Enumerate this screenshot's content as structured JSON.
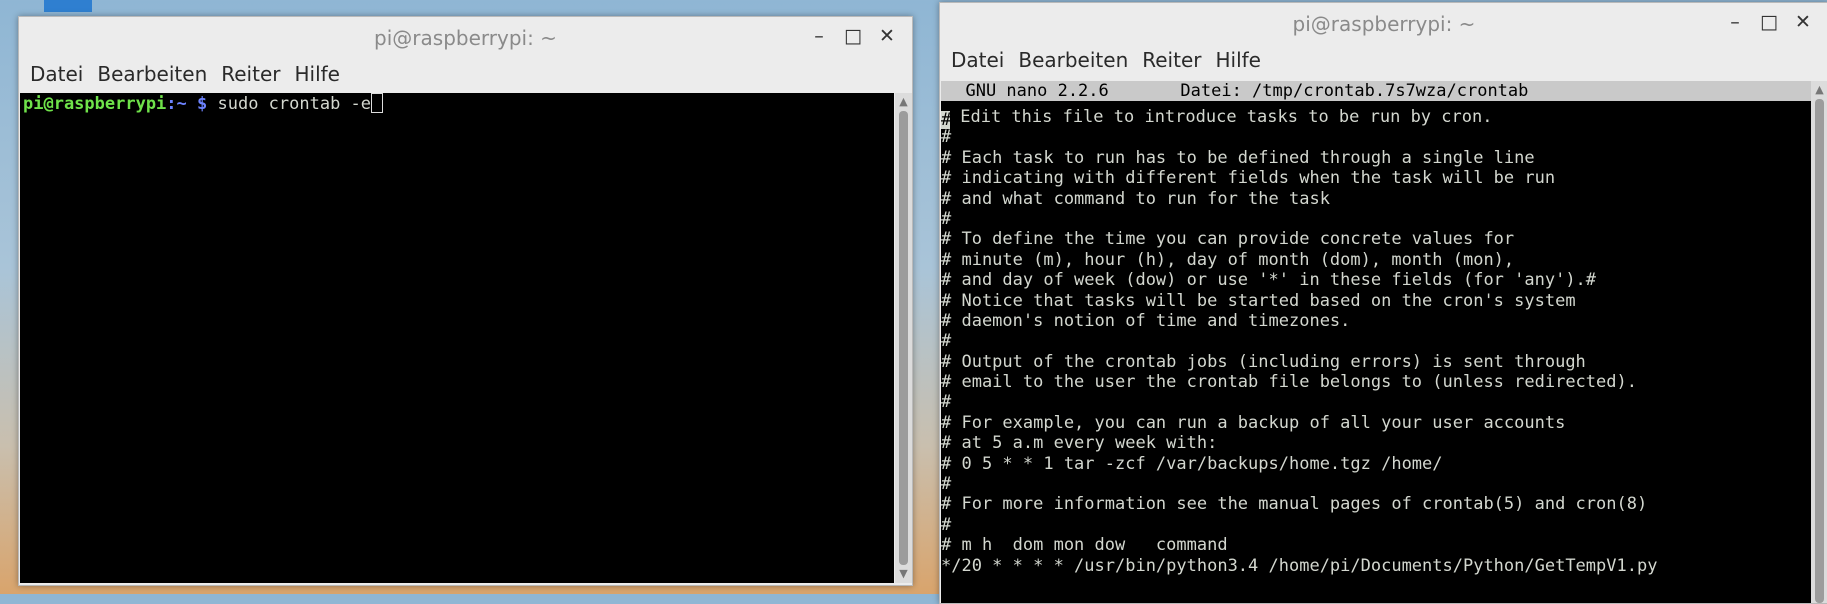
{
  "colors": {
    "terminal_bg": "#000000",
    "prompt_user": "#6fe24a",
    "prompt_path": "#6d83ff",
    "nano_header_bg": "#c9c9c9"
  },
  "left_window": {
    "title": "pi@raspberrypi: ~",
    "buttons": {
      "minimize": "–",
      "maximize": "□",
      "close": "✕"
    },
    "menu": [
      "Datei",
      "Bearbeiten",
      "Reiter",
      "Hilfe"
    ],
    "prompt": {
      "user_host": "pi@raspberrypi",
      "path": ":~ $",
      "command": "sudo crontab -e"
    }
  },
  "right_window": {
    "title": "pi@raspberrypi: ~",
    "buttons": {
      "minimize": "–",
      "maximize": "□",
      "close": "✕"
    },
    "menu": [
      "Datei",
      "Bearbeiten",
      "Reiter",
      "Hilfe"
    ],
    "nano_header": "  GNU nano 2.2.6       Datei: /tmp/crontab.7s7wza/crontab",
    "first_line_rest": " Edit this file to introduce tasks to be run by cron.",
    "lines": [
      "#",
      "# Each task to run has to be defined through a single line",
      "# indicating with different fields when the task will be run",
      "# and what command to run for the task",
      "#",
      "# To define the time you can provide concrete values for",
      "# minute (m), hour (h), day of month (dom), month (mon),",
      "# and day of week (dow) or use '*' in these fields (for 'any').#",
      "# Notice that tasks will be started based on the cron's system",
      "# daemon's notion of time and timezones.",
      "#",
      "# Output of the crontab jobs (including errors) is sent through",
      "# email to the user the crontab file belongs to (unless redirected).",
      "#",
      "# For example, you can run a backup of all your user accounts",
      "# at 5 a.m every week with:",
      "# 0 5 * * 1 tar -zcf /var/backups/home.tgz /home/",
      "#",
      "# For more information see the manual pages of crontab(5) and cron(8)",
      "#",
      "# m h  dom mon dow   command",
      "*/20 * * * * /usr/bin/python3.4 /home/pi/Documents/Python/GetTempV1.py"
    ]
  }
}
